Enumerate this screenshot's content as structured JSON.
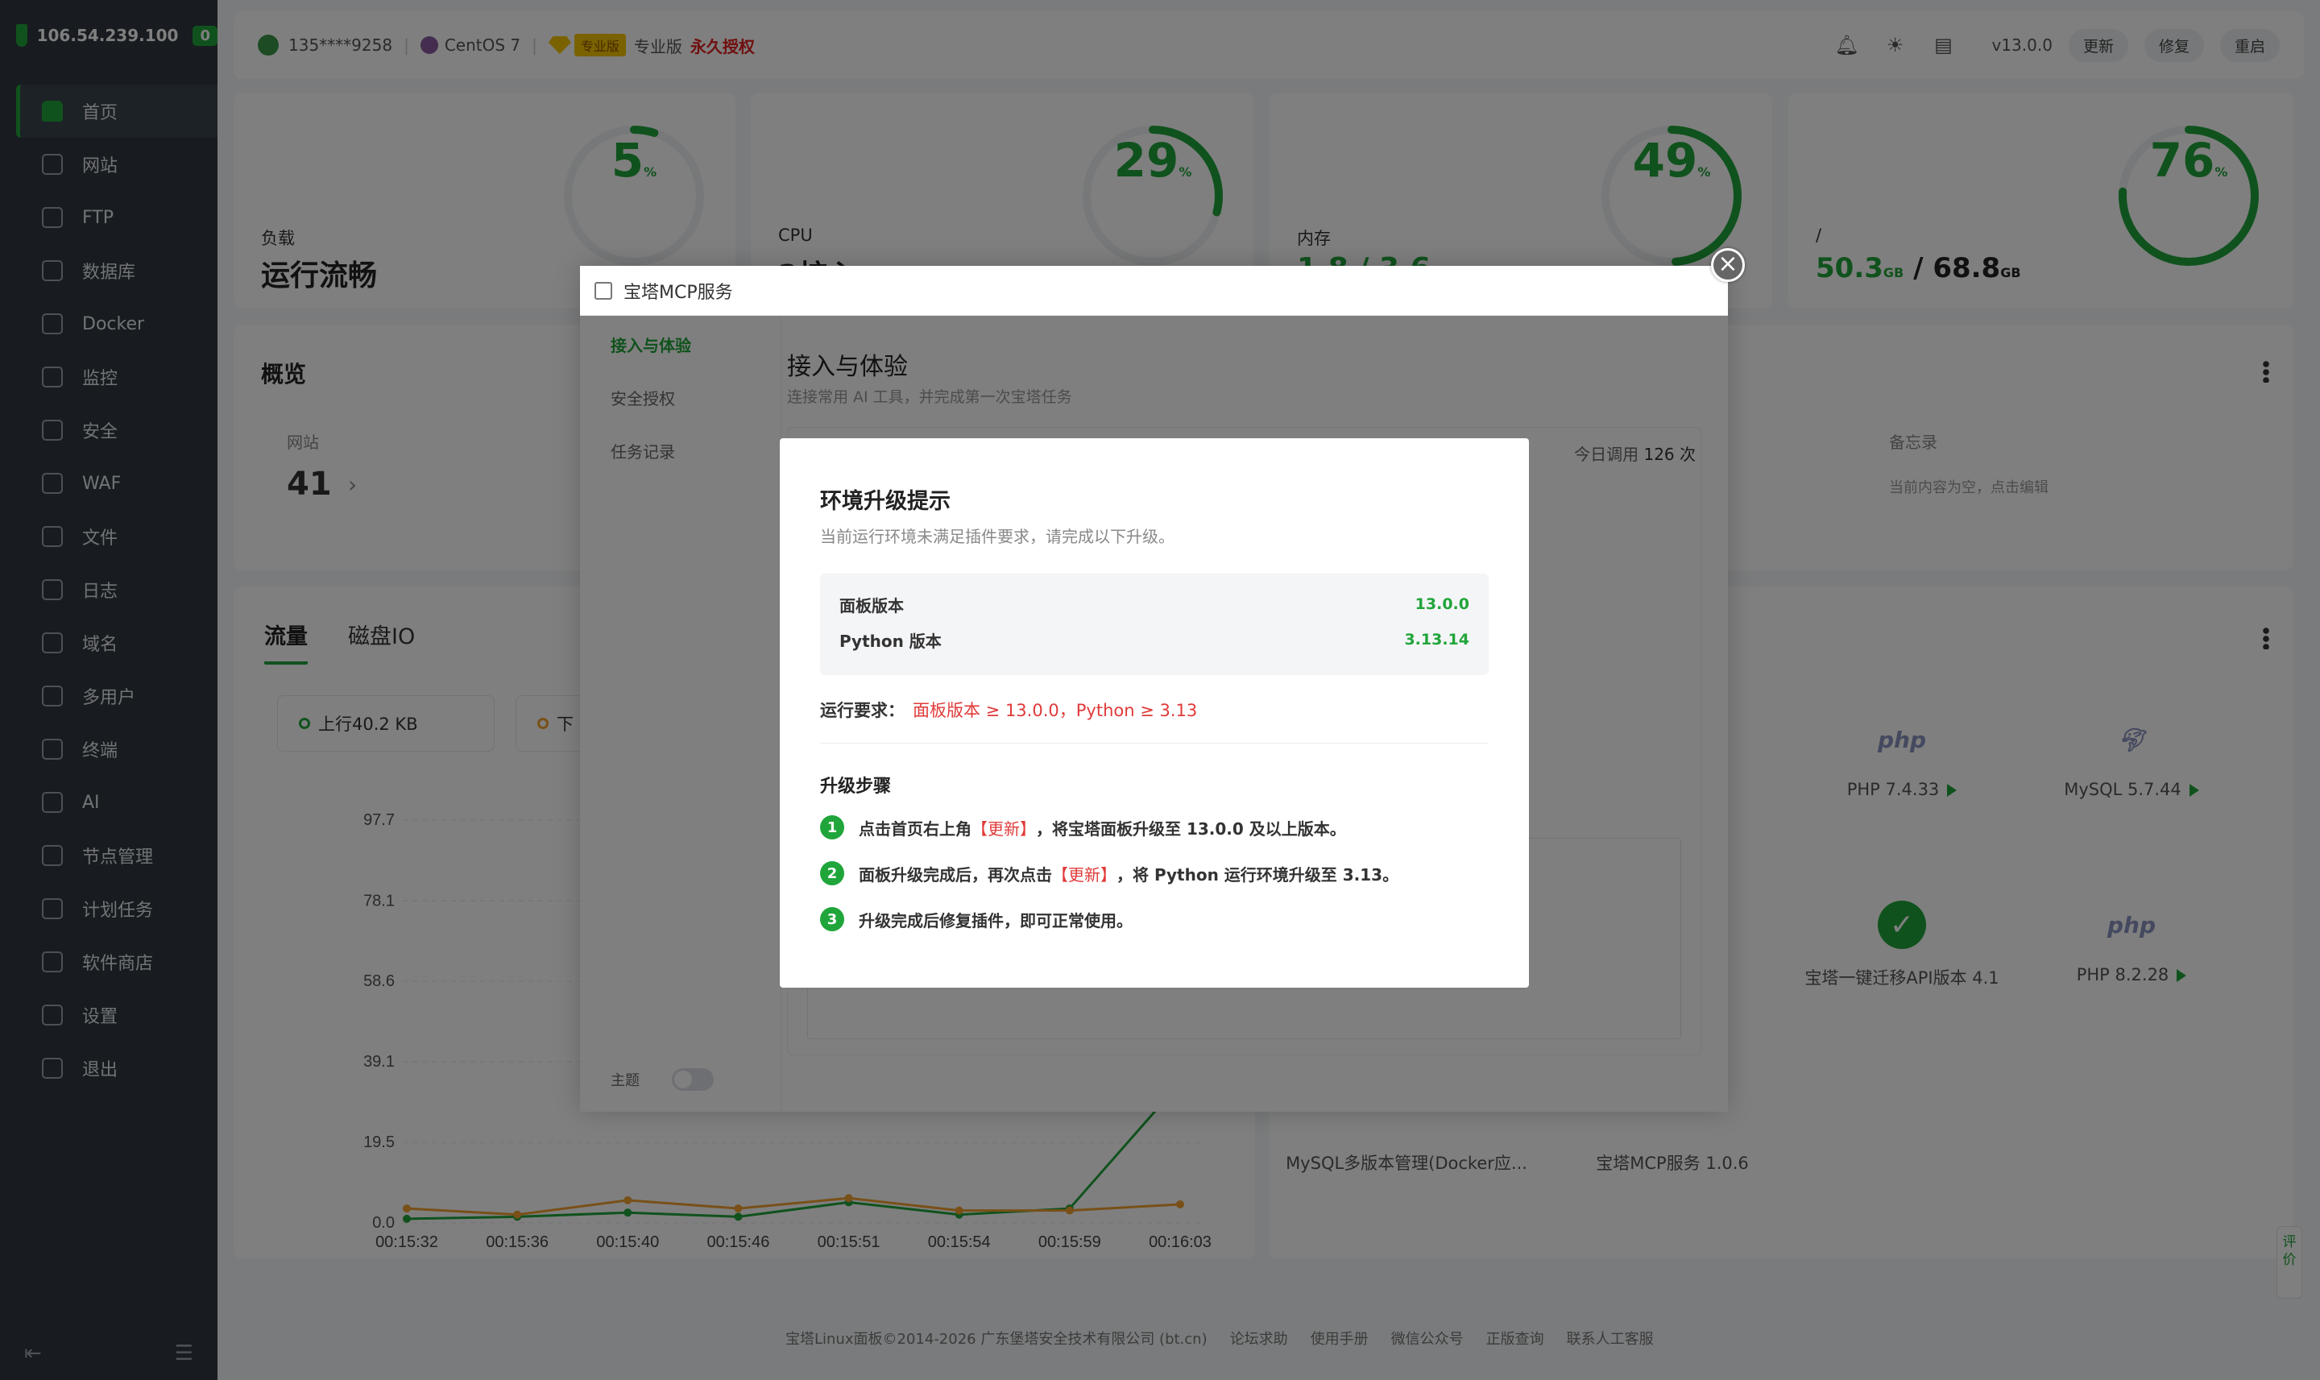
{
  "sidebar": {
    "ip": "106.54.239.100",
    "count": "0",
    "items": [
      "首页",
      "网站",
      "FTP",
      "数据库",
      "Docker",
      "监控",
      "安全",
      "WAF",
      "文件",
      "日志",
      "域名",
      "多用户",
      "终端",
      "AI",
      "节点管理",
      "计划任务",
      "软件商店",
      "设置",
      "退出"
    ]
  },
  "topbar": {
    "user": "135****9258",
    "os": "CentOS 7",
    "pro_badge": "专业版",
    "edition": "专业版",
    "license": "永久授权",
    "version": "v13.0.0",
    "update": "更新",
    "repair": "修复",
    "restart": "重启"
  },
  "status": {
    "load": {
      "percent": "5",
      "label": "负载",
      "value": "运行流畅"
    },
    "cpu": {
      "percent": "29",
      "label": "CPU",
      "value": "2核心"
    },
    "mem": {
      "percent": "49",
      "label": "内存",
      "value": "1.8 / 3.6"
    },
    "disk": {
      "percent": "76",
      "label": "/",
      "used": "50.3",
      "total": "68.8",
      "unit": "GB",
      "sep": "/"
    },
    "pct_unit": "%"
  },
  "overview": {
    "title": "概览",
    "site_label": "网站",
    "site_count": "41",
    "memo_label": "备忘录",
    "memo_text": "当前内容为空，点击编辑"
  },
  "traffic": {
    "tab1": "流量",
    "tab2": "磁盘IO",
    "up": "上行40.2 KB",
    "down": "下"
  },
  "chart_data": {
    "type": "line",
    "x": [
      "00:15:32",
      "00:15:36",
      "00:15:40",
      "00:15:46",
      "00:15:51",
      "00:15:54",
      "00:15:59",
      "00:16:03"
    ],
    "yticks": [
      "97.7",
      "78.1",
      "58.6",
      "39.1",
      "19.5",
      "0.0"
    ],
    "ylim": [
      0,
      97.7
    ],
    "series": [
      {
        "color": "#20a53a",
        "values": [
          1,
          1.5,
          2.5,
          1.5,
          5,
          2,
          3.5,
          34
        ]
      },
      {
        "color": "#f0a030",
        "values": [
          3.5,
          2,
          5.5,
          3.5,
          6,
          3,
          3,
          4.5
        ]
      }
    ]
  },
  "software": {
    "php74": "PHP 7.4.33",
    "mysql": "MySQL 5.7.44",
    "migrate": "宝塔一键迁移API版本 4.1",
    "php82": "PHP 8.2.28",
    "mysqlmulti": "MySQL多版本管理(Docker应...",
    "mcpsvc": "宝塔MCP服务 1.0.6",
    "php_logo": "php"
  },
  "footer": {
    "copyright": "宝塔Linux面板©2014-2026 广东堡塔安全技术有限公司 (bt.cn)",
    "links": [
      "论坛求助",
      "使用手册",
      "微信公众号",
      "正版查询",
      "联系人工客服"
    ]
  },
  "feedback": "评价",
  "mcp": {
    "title": "宝塔MCP服务",
    "nav": [
      "接入与体验",
      "安全授权",
      "任务记录"
    ],
    "theme": "主题",
    "heading": "接入与体验",
    "sub": "连接常用 AI 工具，并完成第一次宝塔任务",
    "calls_label": "今日调用",
    "calls": "126 次"
  },
  "dialog": {
    "title": "环境升级提示",
    "desc": "当前运行环境未满足插件要求，请完成以下升级。",
    "panel_label": "面板版本",
    "panel_value": "13.0.0",
    "python_label": "Python 版本",
    "python_value": "3.13.14",
    "req_label": "运行要求：",
    "req_value": "面板版本 ≥ 13.0.0，Python ≥ 3.13",
    "steps_title": "升级步骤",
    "step1_a": "点击首页右上角",
    "step1_hl": "【更新】",
    "step1_b": "，将宝塔面板升级至 13.0.0 及以上版本。",
    "step2_a": "面板升级完成后，再次点击",
    "step2_hl": "【更新】",
    "step2_b": "，将 Python 运行环境升级至 3.13。",
    "step3": "升级完成后修复插件，即可正常使用。"
  }
}
